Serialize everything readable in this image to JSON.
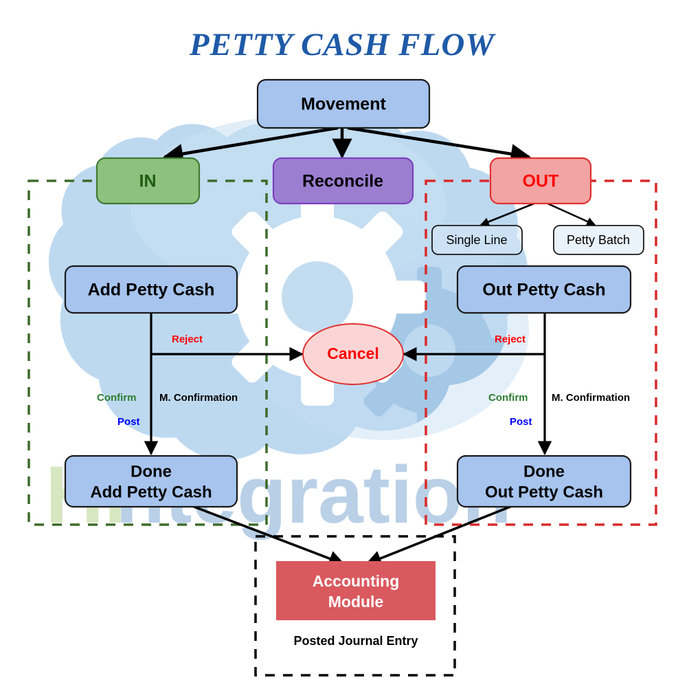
{
  "title": "PETTY CASH FLOW",
  "colors": {
    "title_blue": "#1f5aa8",
    "box_blue_fill": "#a6c4ee",
    "box_blue_stroke": "#1a1a1a",
    "green_fill": "#8cc27d",
    "green_stroke": "#3f7a33",
    "green_text": "#1f5c12",
    "purple_fill": "#9b7ed0",
    "purple_stroke": "#7b3fbf",
    "red_fill": "#f2a3a3",
    "red_stroke": "#e03131",
    "red_text": "#ff0000",
    "cancel_fill": "#fbd5d5",
    "accounting_fill": "#d9595f",
    "accounting_text": "#ffffff",
    "reject_label": "#ff0000",
    "confirm_label": "#2e7d32",
    "post_label": "#0000ff",
    "mconf_label": "#000000",
    "dash_green": "#3d6b2a",
    "dash_red": "#d92b2b",
    "dash_black": "#000000",
    "cloud": "#bcd8ef",
    "cloud_dark": "#a8cbe8",
    "gear_white": "#ffffff",
    "gear_shadow": "#9dc1e0",
    "wm_green": "#d8e8c0",
    "wm_blue": "#b8cfe6"
  },
  "watermark": {
    "part1": "Hi",
    "part2": "ntegration"
  },
  "nodes": {
    "movement": {
      "label": "Movement"
    },
    "in": {
      "label": "IN"
    },
    "reconcile": {
      "label": "Reconcile"
    },
    "out": {
      "label": "OUT"
    },
    "single_line": {
      "label": "Single Line"
    },
    "petty_batch": {
      "label": "Petty Batch"
    },
    "add_petty_cash": {
      "label": "Add Petty Cash"
    },
    "out_petty_cash": {
      "label": "Out Petty Cash"
    },
    "cancel": {
      "label": "Cancel"
    },
    "done_add": {
      "line1": "Done",
      "line2": "Add Petty Cash"
    },
    "done_out": {
      "line1": "Done",
      "line2": "Out Petty Cash"
    },
    "accounting_module": {
      "line1": "Accounting",
      "line2": "Module"
    },
    "posted_journal_entry": {
      "label": "Posted Journal Entry"
    }
  },
  "edge_labels": {
    "reject_left": "Reject",
    "reject_right": "Reject",
    "confirm_left": "Confirm",
    "confirm_right": "Confirm",
    "post_left": "Post",
    "post_right": "Post",
    "mconf_left": "M. Confirmation",
    "mconf_right": "M. Confirmation"
  },
  "groups": {
    "in_group": "IN group (green dashed)",
    "out_group": "OUT group (red dashed)",
    "accounting_group": "Accounting group (black dashed)"
  }
}
